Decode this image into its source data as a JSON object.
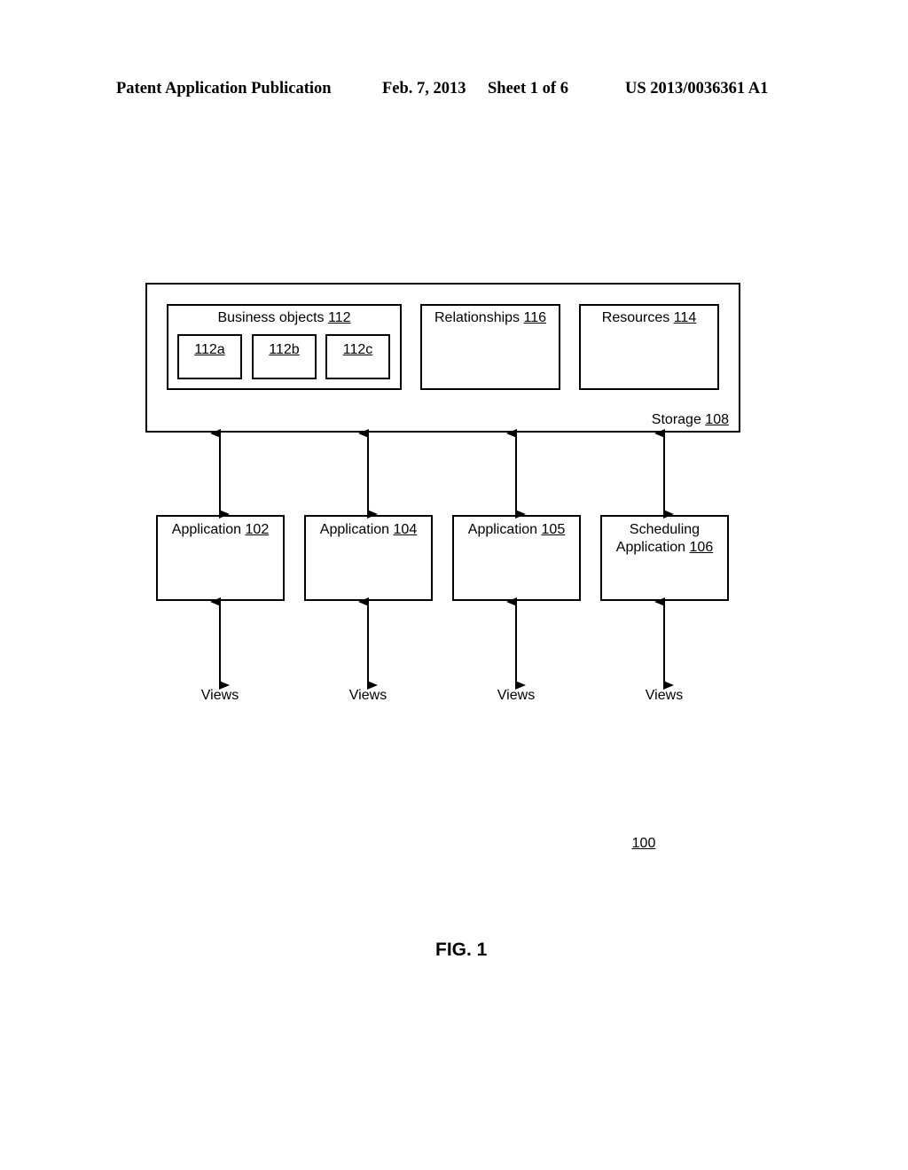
{
  "header": {
    "publication": "Patent Application Publication",
    "date": "Feb. 7, 2013",
    "sheet": "Sheet 1 of 6",
    "number": "US 2013/0036361 A1"
  },
  "storage": {
    "label": "Storage",
    "ref": "108",
    "business_objects": {
      "label": "Business objects",
      "ref": "112",
      "items": [
        "112a",
        "112b",
        "112c"
      ]
    },
    "relationships": {
      "label": "Relationships",
      "ref": "116"
    },
    "resources": {
      "label": "Resources",
      "ref": "114"
    }
  },
  "applications": [
    {
      "label": "Application",
      "ref": "102",
      "prefix": ""
    },
    {
      "label": "Application",
      "ref": "104",
      "prefix": ""
    },
    {
      "label": "Application",
      "ref": "105",
      "prefix": ""
    },
    {
      "label": "Application",
      "ref": "106",
      "prefix": "Scheduling"
    }
  ],
  "views": [
    "Views",
    "Views",
    "Views",
    "Views"
  ],
  "system_ref": "100",
  "figure_label": "FIG. 1"
}
